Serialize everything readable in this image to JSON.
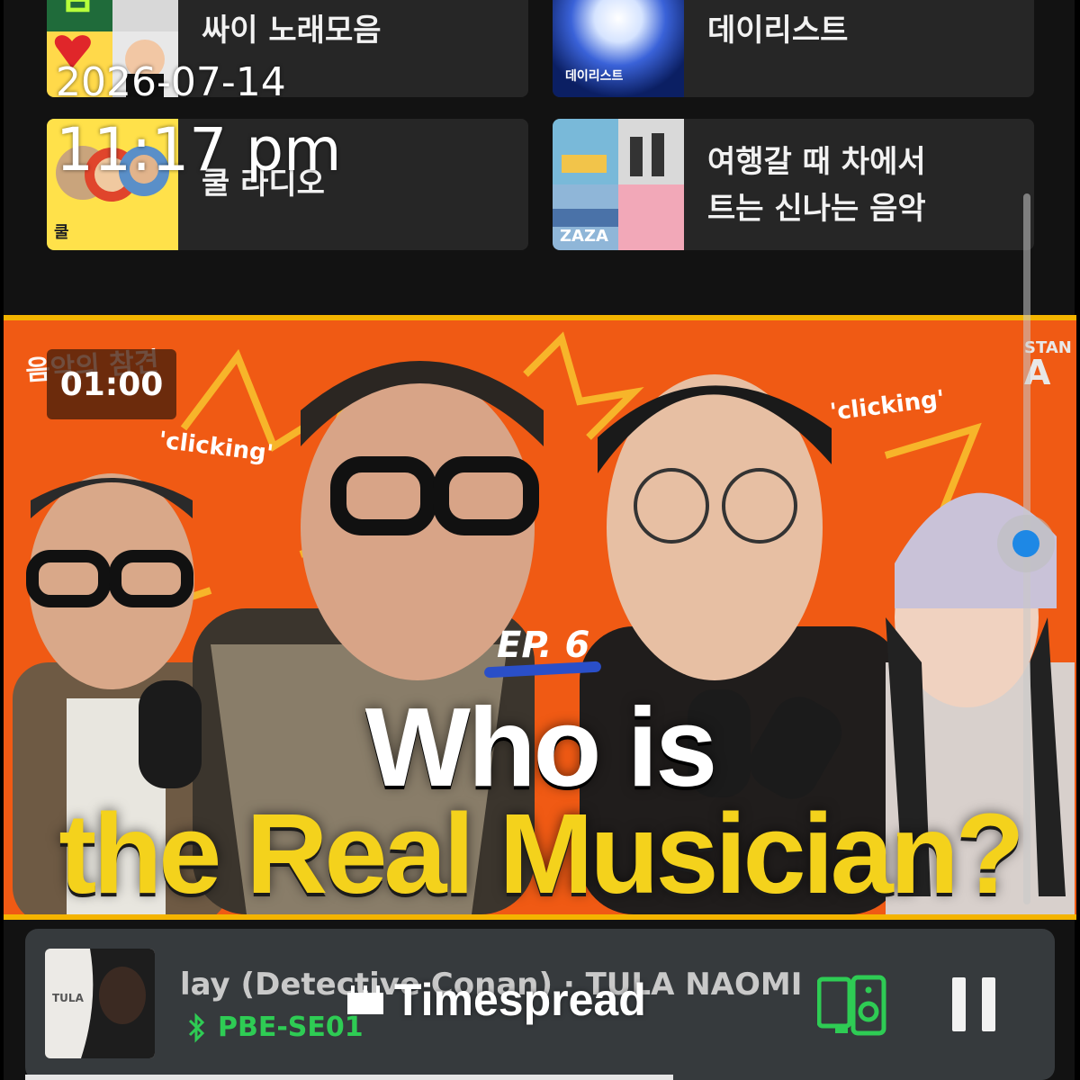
{
  "status": {
    "date": "2026-07-14",
    "time": "11:17 pm"
  },
  "playlists": [
    {
      "title_lines": [
        "싸이 노래모음"
      ],
      "thumb_caption": ""
    },
    {
      "title_lines": [
        "데이리스트"
      ],
      "thumb_caption": "데이리스트"
    },
    {
      "title_lines": [
        "쿨 라디오"
      ],
      "thumb_caption": "쿨"
    },
    {
      "title_lines": [
        "여행갈 때 차에서",
        "트는 신나는 음악"
      ],
      "thumb_caption": "ZAZA"
    }
  ],
  "video": {
    "timer": "01:00",
    "show_logo": "음악의 참견",
    "channel_logo": {
      "top": "STAN",
      "letter": "A"
    },
    "sfx_1": "'clicking'",
    "sfx_2": "'clicking'",
    "episode": "EP. 6",
    "headline_line1": "Who is",
    "headline_line2": "the Real Musician?",
    "colors": {
      "background": "#f05a14",
      "headline2": "#f4d21c",
      "frame": "#f4b400"
    }
  },
  "now_playing": {
    "track": "lay (Detective Conan) · TULA NAOMI",
    "device": "PBE-SE01",
    "album_text": "TULA",
    "accent_color": "#2ecc54"
  },
  "watermark": "Timespread"
}
